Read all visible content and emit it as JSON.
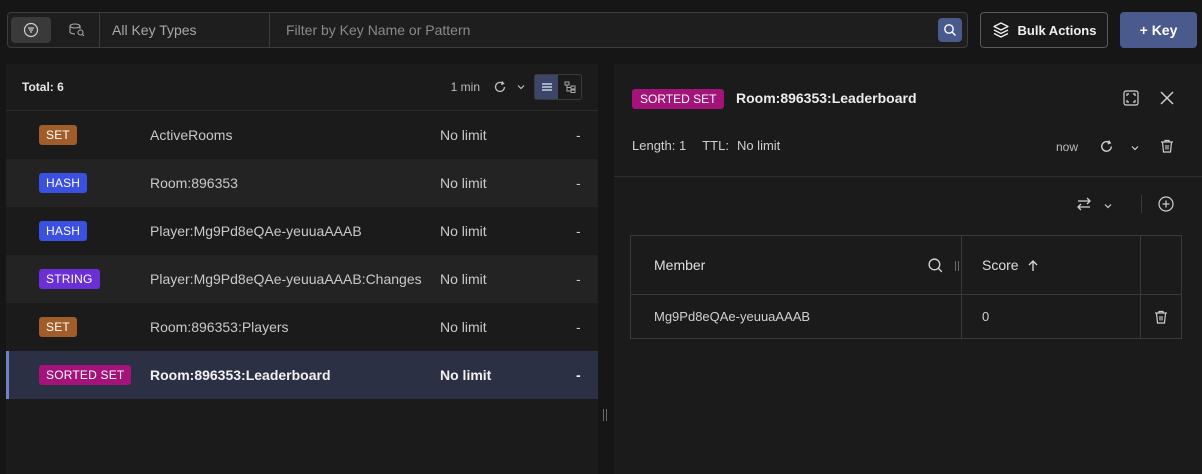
{
  "toolbar": {
    "type_filter": "All Key Types",
    "search_placeholder": "Filter by Key Name or Pattern",
    "bulk_actions_label": "Bulk Actions",
    "add_key_label": "+ Key"
  },
  "key_list": {
    "total_label": "Total: 6",
    "refresh_interval": "1 min",
    "rows": [
      {
        "type": "SET",
        "name": "ActiveRooms",
        "ttl": "No limit",
        "size": "-"
      },
      {
        "type": "HASH",
        "name": "Room:896353",
        "ttl": "No limit",
        "size": "-"
      },
      {
        "type": "HASH",
        "name": "Player:Mg9Pd8eQAe-yeuuaAAAB",
        "ttl": "No limit",
        "size": "-"
      },
      {
        "type": "STRING",
        "name": "Player:Mg9Pd8eQAe-yeuuaAAAB:Changes",
        "ttl": "No limit",
        "size": "-"
      },
      {
        "type": "SET",
        "name": "Room:896353:Players",
        "ttl": "No limit",
        "size": "-"
      },
      {
        "type": "SORTED SET",
        "name": "Room:896353:Leaderboard",
        "ttl": "No limit",
        "size": "-"
      }
    ]
  },
  "detail": {
    "type_badge": "SORTED SET",
    "key_name": "Room:896353:Leaderboard",
    "length_label": "Length: 1",
    "ttl_label": "TTL:",
    "ttl_value": "No limit",
    "last_refresh": "now",
    "table": {
      "member_header": "Member",
      "score_header": "Score",
      "rows": [
        {
          "member": "Mg9Pd8eQAe-yeuuaAAAB",
          "score": "0"
        }
      ]
    }
  },
  "colors": {
    "set": "#a05d2a",
    "hash": "#3b4fe0",
    "string": "#6a2fd6",
    "sorted_set": "#a4137a",
    "accent": "#4a5a8c"
  }
}
